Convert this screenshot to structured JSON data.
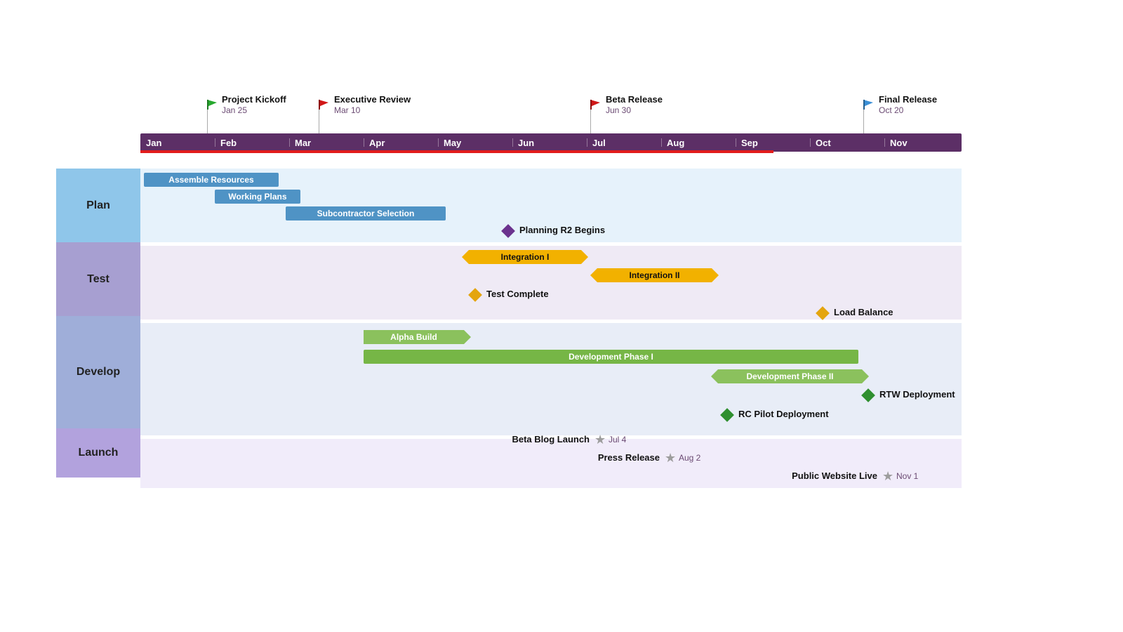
{
  "chart_data": {
    "type": "gantt_timeline",
    "timeline": {
      "months": [
        "Jan",
        "Feb",
        "Mar",
        "Apr",
        "May",
        "Jun",
        "Jul",
        "Aug",
        "Sep",
        "Oct",
        "Nov"
      ],
      "progress_end_month": "Sep"
    },
    "milestone_flags": [
      {
        "title": "Project Kickoff",
        "date": "Jan 25",
        "color": "green",
        "month_pos": 0.8
      },
      {
        "title": "Executive Review",
        "date": "Mar 10",
        "color": "red",
        "month_pos": 2.3
      },
      {
        "title": "Beta Release",
        "date": "Jun 30",
        "color": "red",
        "month_pos": 5.95
      },
      {
        "title": "Final Release",
        "date": "Oct 20",
        "color": "blue",
        "month_pos": 9.62
      }
    ],
    "swimlanes": [
      {
        "name": "Plan",
        "color": "#8fc6ea",
        "items": [
          {
            "type": "bar",
            "label": "Assemble Resources",
            "start": 0.05,
            "end": 1.85,
            "row": 0,
            "style": "blue"
          },
          {
            "type": "bar",
            "label": "Working Plans",
            "start": 1.0,
            "end": 2.15,
            "row": 1,
            "style": "blue"
          },
          {
            "type": "bar",
            "label": "Subcontractor Selection",
            "start": 1.95,
            "end": 4.1,
            "row": 2,
            "style": "blue"
          },
          {
            "type": "milestone",
            "label": "Planning R2 Begins",
            "pos": 4.87,
            "row": 3,
            "style": "purple"
          }
        ]
      },
      {
        "name": "Test",
        "color": "#a79fd1",
        "items": [
          {
            "type": "arrow_both",
            "label": "Integration I",
            "start": 4.32,
            "end": 5.92,
            "row": 0,
            "style": "gold"
          },
          {
            "type": "arrow_both",
            "label": "Integration II",
            "start": 6.05,
            "end": 7.68,
            "row": 1,
            "style": "gold"
          },
          {
            "type": "milestone",
            "label": "Test Complete",
            "pos": 4.43,
            "row": 2,
            "style": "gold"
          },
          {
            "type": "milestone",
            "label": "Load Balance",
            "pos": 9.1,
            "row": 3,
            "style": "gold"
          }
        ]
      },
      {
        "name": "Develop",
        "color": "#9faed9",
        "items": [
          {
            "type": "arrow_right",
            "label": "Alpha Build",
            "start": 3.0,
            "end": 4.35,
            "row": 0,
            "style": "green"
          },
          {
            "type": "bar",
            "label": "Development Phase I",
            "start": 3.0,
            "end": 9.65,
            "row": 1,
            "style": "green"
          },
          {
            "type": "arrow_left_right",
            "label": "Development Phase II",
            "start": 7.67,
            "end": 9.7,
            "row": 2,
            "style": "green_arrow"
          },
          {
            "type": "milestone",
            "label": "RTW Deployment",
            "pos": 9.72,
            "row": 3,
            "style": "green"
          },
          {
            "type": "milestone",
            "label": "RC Pilot Deployment",
            "pos": 7.82,
            "row": 4,
            "style": "green"
          }
        ]
      },
      {
        "name": "Launch",
        "color": "#b2a2dd",
        "items": [
          {
            "type": "star",
            "label": "Beta Blog Launch",
            "date": "Jul 4",
            "pos": 6.1,
            "row": 0
          },
          {
            "type": "star",
            "label": "Press Release",
            "date": "Aug 2",
            "pos": 7.04,
            "row": 1
          },
          {
            "type": "star",
            "label": "Public Website Live",
            "date": "Nov 1",
            "pos": 10.02,
            "row": 2
          }
        ]
      }
    ]
  },
  "lane_plan": "Plan",
  "lane_test": "Test",
  "lane_dev": "Develop",
  "lane_launch": "Launch",
  "m0": "Jan",
  "m1": "Feb",
  "m2": "Mar",
  "m3": "Apr",
  "m4": "May",
  "m5": "Jun",
  "m6": "Jul",
  "m7": "Aug",
  "m8": "Sep",
  "m9": "Oct",
  "m10": "Nov",
  "f0t": "Project Kickoff",
  "f0d": "Jan 25",
  "f1t": "Executive Review",
  "f1d": "Mar 10",
  "f2t": "Beta Release",
  "f2d": "Jun 30",
  "f3t": "Final Release",
  "f3d": "Oct 20",
  "b_asm": "Assemble Resources",
  "b_wp": "Working Plans",
  "b_sub": "Subcontractor Selection",
  "b_pr2": "Planning R2 Begins",
  "b_i1": "Integration I",
  "b_i2": "Integration II",
  "b_tc": "Test Complete",
  "b_lb": "Load Balance",
  "b_ab": "Alpha Build",
  "b_dp1": "Development Phase I",
  "b_dp2": "Development Phase II",
  "b_rtw": "RTW Deployment",
  "b_rcp": "RC Pilot Deployment",
  "s_bbl": "Beta Blog Launch",
  "s_bbl_d": "Jul 4",
  "s_pr": "Press Release",
  "s_pr_d": "Aug 2",
  "s_pwl": "Public Website Live",
  "s_pwl_d": "Nov 1"
}
